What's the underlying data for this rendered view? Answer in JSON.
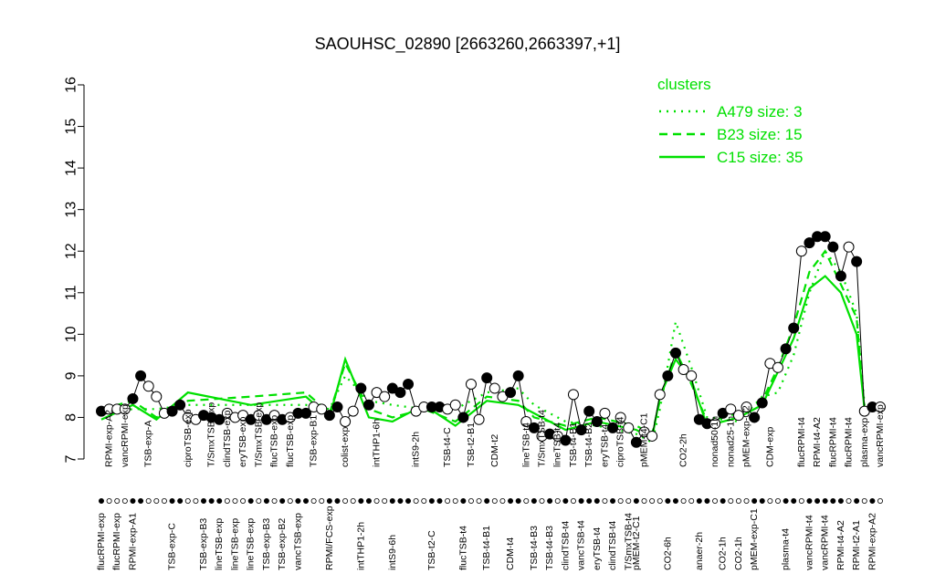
{
  "chart_data": {
    "type": "line",
    "title": "SAOUHSC_02890 [2663260,2663397,+1]",
    "xlabel": "",
    "ylabel": "",
    "ylim": [
      7,
      16
    ],
    "yticks": [
      "7",
      "8",
      "9",
      "10",
      "11",
      "12",
      "13",
      "14",
      "15",
      "16"
    ],
    "legend": {
      "title": "clusters",
      "placement": "top-right",
      "entries": [
        {
          "label": "A479 size: 3",
          "style": "dotted"
        },
        {
          "label": "B23 size: 15",
          "style": "dashed"
        },
        {
          "label": "C15 size: 35",
          "style": "solid"
        }
      ]
    },
    "colors": {
      "cluster": "#00e000",
      "points": "#000000",
      "line": "#000000"
    },
    "points": [
      [
        "flucRPMI-exp",
        8.15,
        1,
        "b"
      ],
      [
        "RPMI-exp-A2",
        8.2,
        0,
        "t"
      ],
      [
        "flucRPMI-exp",
        8.2,
        0,
        "b"
      ],
      [
        "vancRPMI-exp",
        8.2,
        0,
        "t"
      ],
      [
        "RPMI-exp-A1",
        8.45,
        1,
        "b"
      ],
      [
        "",
        9.0,
        1,
        ""
      ],
      [
        "TSB-exp-A",
        8.75,
        0,
        "t"
      ],
      [
        "",
        8.5,
        0,
        ""
      ],
      [
        "",
        8.1,
        0,
        ""
      ],
      [
        "TSB-exp-C",
        8.15,
        1,
        "b"
      ],
      [
        "",
        8.3,
        1,
        ""
      ],
      [
        "ciproTSB-exp",
        8.0,
        0,
        "t"
      ],
      [
        "",
        7.95,
        0,
        ""
      ],
      [
        "TSB-exp-B3",
        8.05,
        1,
        "b"
      ],
      [
        "T/SmxTSB-exp",
        8.0,
        1,
        "t"
      ],
      [
        "lineTSB-exp",
        7.95,
        1,
        "b"
      ],
      [
        "clindTSB-exp",
        8.1,
        0,
        "t"
      ],
      [
        "lineTSB-exp",
        8.0,
        0,
        "b"
      ],
      [
        "eryTSB-exp",
        8.05,
        0,
        "t"
      ],
      [
        "lineTSB-exp",
        7.95,
        1,
        "b"
      ],
      [
        "T/SmxTSB-exp",
        8.05,
        0,
        "t"
      ],
      [
        "TSB-exp-B3",
        7.95,
        1,
        "b"
      ],
      [
        "flucTSB-exp",
        8.05,
        0,
        "t"
      ],
      [
        "TSB-exp-B2",
        7.95,
        1,
        "b"
      ],
      [
        "flucTSB-exp",
        8.0,
        0,
        "t"
      ],
      [
        "vancTSB-exp",
        8.1,
        1,
        "b"
      ],
      [
        "",
        8.1,
        1,
        ""
      ],
      [
        "TSB-exp-B1",
        8.25,
        0,
        "t"
      ],
      [
        "",
        8.2,
        0,
        ""
      ],
      [
        "RPMI/FCS-exp",
        8.05,
        1,
        "b"
      ],
      [
        "",
        8.25,
        1,
        ""
      ],
      [
        "colist-exp",
        7.9,
        0,
        "t"
      ],
      [
        "",
        8.15,
        0,
        ""
      ],
      [
        "intTHP1-2h",
        8.7,
        1,
        "b"
      ],
      [
        "",
        8.3,
        1,
        ""
      ],
      [
        "intTHP1-6h",
        8.6,
        0,
        "t"
      ],
      [
        "",
        8.5,
        0,
        ""
      ],
      [
        "intS9-6h",
        8.7,
        1,
        "b"
      ],
      [
        "",
        8.6,
        1,
        ""
      ],
      [
        "",
        8.8,
        1,
        ""
      ],
      [
        "intS9-2h",
        8.15,
        0,
        "t"
      ],
      [
        "",
        8.25,
        0,
        ""
      ],
      [
        "TSB-t2-C",
        8.25,
        1,
        "b"
      ],
      [
        "",
        8.25,
        1,
        ""
      ],
      [
        "TSB-t4-C",
        8.2,
        0,
        "t"
      ],
      [
        "",
        8.3,
        0,
        ""
      ],
      [
        "flucTSB-t4",
        8.0,
        1,
        "b"
      ],
      [
        "TSB-t2-B1",
        8.8,
        0,
        "t"
      ],
      [
        "",
        7.95,
        0,
        ""
      ],
      [
        "TSB-t4-B1",
        8.95,
        1,
        "b"
      ],
      [
        "CDM-t2",
        8.7,
        0,
        "t"
      ],
      [
        "",
        8.5,
        0,
        ""
      ],
      [
        "CDM-t4",
        8.6,
        1,
        "b"
      ],
      [
        "",
        9.0,
        1,
        ""
      ],
      [
        "lineTSB-t4",
        7.9,
        0,
        "t"
      ],
      [
        "TSB-t4-B3",
        7.75,
        1,
        "b"
      ],
      [
        "T/SmxTSB-t4",
        7.55,
        0,
        "t"
      ],
      [
        "TSB-t4-B3",
        7.6,
        1,
        "b"
      ],
      [
        "lineTSB-t4",
        7.55,
        0,
        "t"
      ],
      [
        "clindTSB-t4",
        7.45,
        1,
        "b"
      ],
      [
        "TSB-t4-B1",
        8.55,
        0,
        "t"
      ],
      [
        "vancTSB-t4",
        7.7,
        1,
        "b"
      ],
      [
        "TSB-t4-B2",
        8.15,
        1,
        "t"
      ],
      [
        "eryTSB-t4",
        7.9,
        1,
        "b"
      ],
      [
        "eryTSB-t4",
        8.1,
        0,
        "t"
      ],
      [
        "clindTSB-t4",
        7.75,
        1,
        "b"
      ],
      [
        "ciproTSB-t4",
        8.0,
        0,
        "t"
      ],
      [
        "T/SmxTSB-t4",
        7.75,
        0,
        "b"
      ],
      [
        "pMEM-t2-C1",
        7.4,
        1,
        "b"
      ],
      [
        "pMEM-t4-C1",
        7.65,
        0,
        "t"
      ],
      [
        "",
        7.55,
        0,
        ""
      ],
      [
        "",
        8.55,
        0,
        ""
      ],
      [
        "CO2-6h",
        9.0,
        1,
        "b"
      ],
      [
        "",
        9.55,
        1,
        ""
      ],
      [
        "CO2-2h",
        9.15,
        0,
        "t"
      ],
      [
        "",
        9.0,
        0,
        ""
      ],
      [
        "anaer-2h",
        7.95,
        1,
        "b"
      ],
      [
        "",
        7.85,
        1,
        ""
      ],
      [
        "nonad50-1h",
        7.85,
        0,
        "t"
      ],
      [
        "CO2-1h",
        8.1,
        1,
        "b"
      ],
      [
        "nonad25-1h",
        8.2,
        0,
        "t"
      ],
      [
        "CO2-1h",
        8.05,
        0,
        "b"
      ],
      [
        "pMEM-exp-C2",
        8.25,
        0,
        "t"
      ],
      [
        "pMEM-exp-C1",
        8.0,
        1,
        "b"
      ],
      [
        "",
        8.35,
        1,
        ""
      ],
      [
        "CDM-exp",
        9.3,
        0,
        "t"
      ],
      [
        "",
        9.2,
        0,
        ""
      ],
      [
        "plasma-t4",
        9.65,
        1,
        "b"
      ],
      [
        "",
        10.15,
        1,
        ""
      ],
      [
        "flucRPMI-t4",
        12.0,
        0,
        "t"
      ],
      [
        "vancRPMI-t4",
        12.2,
        1,
        "b"
      ],
      [
        "RPMI-t4-A2",
        12.35,
        1,
        "t"
      ],
      [
        "vancRPMI-t4",
        12.35,
        1,
        "b"
      ],
      [
        "flucRPMI-t4",
        12.1,
        1,
        "t"
      ],
      [
        "RPMI-t4-A2",
        11.4,
        1,
        "b"
      ],
      [
        "flucRPMI-t4",
        12.1,
        0,
        "t"
      ],
      [
        "RPMI-t2-A1",
        11.75,
        1,
        "b"
      ],
      [
        "plasma-exp",
        8.15,
        0,
        "t"
      ],
      [
        "RPMI-exp-A2",
        8.25,
        1,
        "b"
      ],
      [
        "vancRPMI-exp",
        8.25,
        0,
        "t"
      ]
    ],
    "cluster_series": [
      {
        "name": "C15",
        "style": "solid",
        "keypoints": [
          [
            0,
            7.95
          ],
          [
            4,
            8.3
          ],
          [
            7,
            7.95
          ],
          [
            11,
            8.6
          ],
          [
            19,
            8.3
          ],
          [
            26,
            8.5
          ],
          [
            29,
            8.0
          ],
          [
            31,
            9.4
          ],
          [
            34,
            8.0
          ],
          [
            37,
            7.9
          ],
          [
            41,
            8.3
          ],
          [
            45,
            7.8
          ],
          [
            49,
            8.4
          ],
          [
            53,
            8.3
          ],
          [
            55,
            8.1
          ],
          [
            59,
            7.7
          ],
          [
            63,
            7.9
          ],
          [
            68,
            7.7
          ],
          [
            70,
            7.5
          ],
          [
            71,
            8.5
          ],
          [
            73,
            9.4
          ],
          [
            75,
            8.9
          ],
          [
            77,
            7.8
          ],
          [
            81,
            8.0
          ],
          [
            84,
            8.3
          ],
          [
            86,
            9.1
          ],
          [
            88,
            9.9
          ],
          [
            90,
            11.1
          ],
          [
            92,
            11.4
          ],
          [
            94,
            11.0
          ],
          [
            96,
            10.0
          ],
          [
            97,
            8.2
          ],
          [
            99,
            8.2
          ]
        ]
      },
      {
        "name": "B23",
        "style": "dashed",
        "keypoints": [
          [
            0,
            8.2
          ],
          [
            4,
            8.4
          ],
          [
            7,
            8.0
          ],
          [
            11,
            8.4
          ],
          [
            19,
            8.5
          ],
          [
            26,
            8.6
          ],
          [
            29,
            8.1
          ],
          [
            31,
            9.3
          ],
          [
            34,
            8.2
          ],
          [
            37,
            8.0
          ],
          [
            41,
            8.2
          ],
          [
            45,
            7.9
          ],
          [
            49,
            8.5
          ],
          [
            53,
            8.4
          ],
          [
            55,
            8.0
          ],
          [
            59,
            7.8
          ],
          [
            63,
            8.0
          ],
          [
            68,
            7.8
          ],
          [
            70,
            7.6
          ],
          [
            71,
            8.4
          ],
          [
            73,
            9.6
          ],
          [
            75,
            8.8
          ],
          [
            77,
            7.9
          ],
          [
            81,
            8.1
          ],
          [
            84,
            8.4
          ],
          [
            86,
            9.2
          ],
          [
            88,
            10.2
          ],
          [
            90,
            11.5
          ],
          [
            92,
            12.0
          ],
          [
            94,
            11.2
          ],
          [
            96,
            10.4
          ],
          [
            97,
            8.2
          ],
          [
            99,
            8.2
          ]
        ]
      },
      {
        "name": "A479",
        "style": "dotted",
        "keypoints": [
          [
            0,
            8.1
          ],
          [
            4,
            8.2
          ],
          [
            7,
            8.2
          ],
          [
            11,
            8.3
          ],
          [
            19,
            8.3
          ],
          [
            26,
            8.3
          ],
          [
            29,
            8.2
          ],
          [
            31,
            9.0
          ],
          [
            34,
            8.4
          ],
          [
            37,
            8.3
          ],
          [
            41,
            8.2
          ],
          [
            45,
            8.2
          ],
          [
            49,
            8.6
          ],
          [
            53,
            8.7
          ],
          [
            55,
            8.3
          ],
          [
            59,
            7.9
          ],
          [
            63,
            7.8
          ],
          [
            68,
            7.6
          ],
          [
            70,
            7.4
          ],
          [
            71,
            8.2
          ],
          [
            73,
            10.3
          ],
          [
            75,
            9.2
          ],
          [
            77,
            8.0
          ],
          [
            81,
            7.9
          ],
          [
            84,
            8.5
          ],
          [
            86,
            8.6
          ],
          [
            88,
            9.5
          ],
          [
            90,
            11.0
          ],
          [
            92,
            12.0
          ],
          [
            94,
            11.5
          ],
          [
            96,
            10.5
          ],
          [
            97,
            8.3
          ],
          [
            99,
            8.2
          ]
        ]
      }
    ]
  }
}
